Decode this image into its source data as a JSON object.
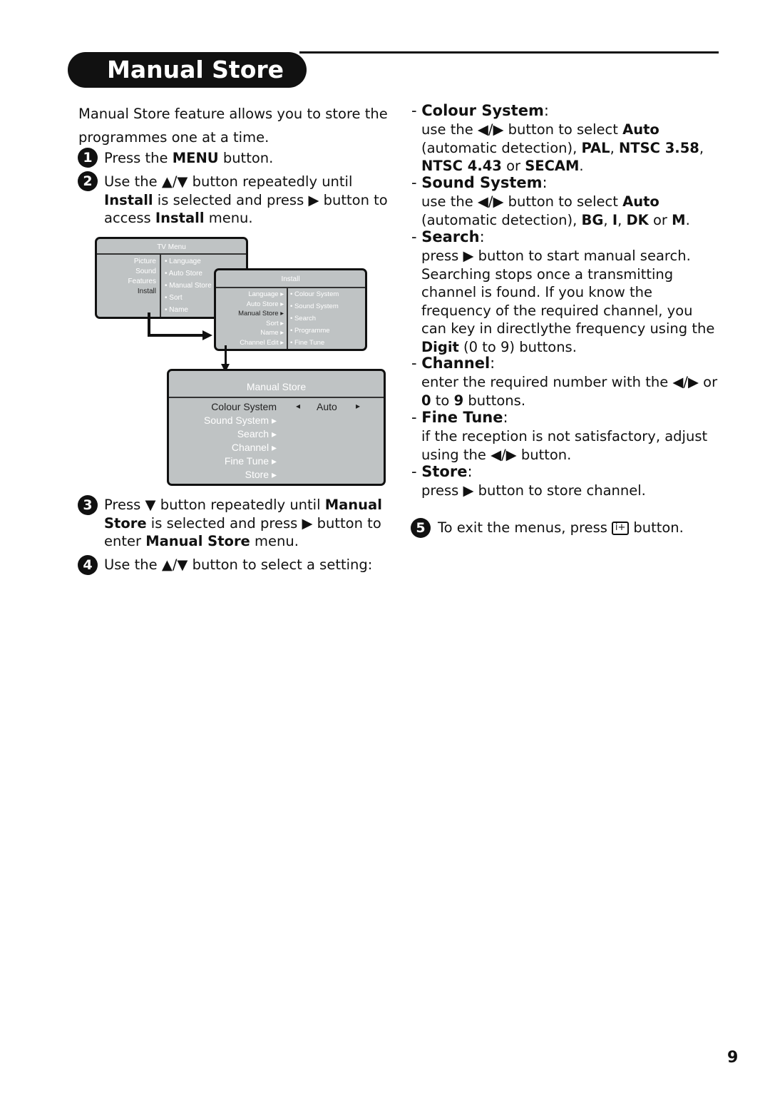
{
  "title": "Manual Store",
  "intro": [
    {
      "t": "Manual Store feature allows you to store the programmes one at a time."
    }
  ],
  "steps": [
    {
      "n": "1",
      "text": [
        {
          "t": "Press the "
        },
        {
          "t": "MENU",
          "b": 1
        },
        {
          "t": " button."
        }
      ]
    },
    {
      "n": "2",
      "text": [
        {
          "t": "Use the ▲/▼ button repeatedly until "
        },
        {
          "t": "Install",
          "b": 1
        },
        {
          "t": " is selected and press ▶ button to access "
        },
        {
          "t": "Install",
          "b": 1
        },
        {
          "t": " menu."
        }
      ]
    },
    {
      "n": "3",
      "text": [
        {
          "t": "Press ▼ button repeatedly until "
        },
        {
          "t": "Manual Store",
          "b": 1
        },
        {
          "t": " is selected and press ▶ button to enter "
        },
        {
          "t": "Manual Store",
          "b": 1
        },
        {
          "t": " menu."
        }
      ]
    },
    {
      "n": "4",
      "text": [
        {
          "t": "Use the ▲/▼ button to select a setting:"
        }
      ]
    },
    {
      "n": "5",
      "text": [
        {
          "t": "To exit the menus, press "
        },
        {
          "t": "i+",
          "icon": 1
        },
        {
          "t": " button."
        }
      ]
    }
  ],
  "settings": [
    {
      "heading": "Colour System",
      "desc": [
        {
          "t": "use the ◀/▶ button to select "
        },
        {
          "t": "Auto",
          "b": 1
        },
        {
          "t": " (automatic detection), "
        },
        {
          "t": "PAL",
          "b": 1
        },
        {
          "t": ", "
        },
        {
          "t": "NTSC 3.58",
          "b": 1
        },
        {
          "t": ", "
        },
        {
          "t": "NTSC 4.43",
          "b": 1
        },
        {
          "t": " or "
        },
        {
          "t": "SECAM",
          "b": 1
        },
        {
          "t": "."
        }
      ]
    },
    {
      "heading": "Sound System",
      "desc": [
        {
          "t": "use the ◀/▶ button to select "
        },
        {
          "t": "Auto",
          "b": 1
        },
        {
          "t": " (automatic detection), "
        },
        {
          "t": "BG",
          "b": 1
        },
        {
          "t": ", "
        },
        {
          "t": "I",
          "b": 1
        },
        {
          "t": ", "
        },
        {
          "t": "DK",
          "b": 1
        },
        {
          "t": " or "
        },
        {
          "t": "M",
          "b": 1
        },
        {
          "t": "."
        }
      ]
    },
    {
      "heading": "Search",
      "desc": [
        {
          "t": "press ▶ button to start manual search. Searching stops once a transmitting channel is found. If you know the frequency of the required channel, you can key in directlythe frequency using the "
        },
        {
          "t": "Digit",
          "b": 1
        },
        {
          "t": " (0 to 9) buttons."
        }
      ]
    },
    {
      "heading": "Channel",
      "desc": [
        {
          "t": "enter the required number with the ◀/▶ or "
        },
        {
          "t": "0",
          "b": 1
        },
        {
          "t": " to "
        },
        {
          "t": "9",
          "b": 1
        },
        {
          "t": " buttons."
        }
      ]
    },
    {
      "heading": "Fine Tune",
      "desc": [
        {
          "t": "if the reception is not satisfactory, adjust using the ◀/▶ button."
        }
      ]
    },
    {
      "heading": "Store",
      "desc": [
        {
          "t": "press ▶ button to store channel."
        }
      ]
    }
  ],
  "tv_menu": {
    "title": "TV Menu",
    "items": [
      "Picture",
      "Sound",
      "Features",
      "Install"
    ],
    "sub": [
      "Language",
      "Auto Store",
      "Manual Store",
      "Sort",
      "Name"
    ]
  },
  "install_menu": {
    "title": "Install",
    "items": [
      "Language ▸",
      "Auto Store ▸",
      "Manual Store ▸",
      "Sort ▸",
      "Name ▸",
      "Channel Edit ▸"
    ],
    "sub": [
      "Colour System",
      "Sound System",
      "Search",
      "Programme",
      "Fine Tune"
    ]
  },
  "manual_menu": {
    "title": "Manual Store",
    "items": [
      "Colour System",
      "Sound System ▸",
      "Search ▸",
      "Channel ▸",
      "Fine Tune ▸",
      "Store ▸"
    ],
    "value": "Auto"
  },
  "page_number": "9"
}
